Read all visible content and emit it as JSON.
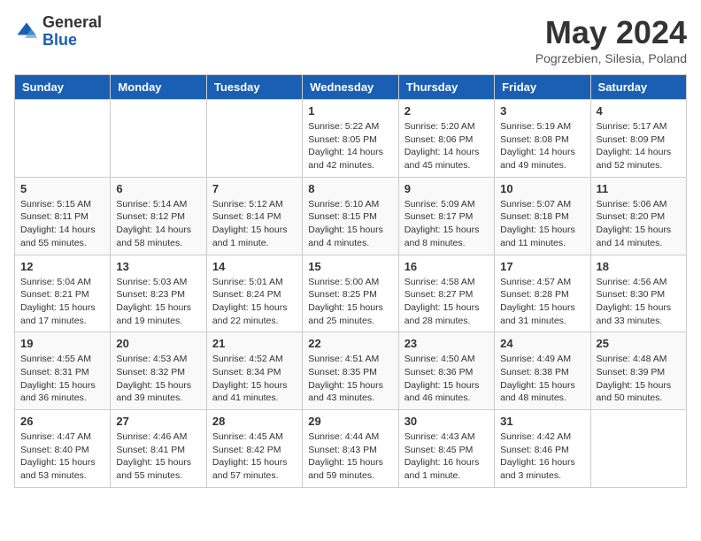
{
  "logo": {
    "general": "General",
    "blue": "Blue"
  },
  "header": {
    "month": "May 2024",
    "location": "Pogrzebien, Silesia, Poland"
  },
  "weekdays": [
    "Sunday",
    "Monday",
    "Tuesday",
    "Wednesday",
    "Thursday",
    "Friday",
    "Saturday"
  ],
  "weeks": [
    [
      {
        "day": "",
        "sunrise": "",
        "sunset": "",
        "daylight": ""
      },
      {
        "day": "",
        "sunrise": "",
        "sunset": "",
        "daylight": ""
      },
      {
        "day": "",
        "sunrise": "",
        "sunset": "",
        "daylight": ""
      },
      {
        "day": "1",
        "sunrise": "Sunrise: 5:22 AM",
        "sunset": "Sunset: 8:05 PM",
        "daylight": "Daylight: 14 hours and 42 minutes."
      },
      {
        "day": "2",
        "sunrise": "Sunrise: 5:20 AM",
        "sunset": "Sunset: 8:06 PM",
        "daylight": "Daylight: 14 hours and 45 minutes."
      },
      {
        "day": "3",
        "sunrise": "Sunrise: 5:19 AM",
        "sunset": "Sunset: 8:08 PM",
        "daylight": "Daylight: 14 hours and 49 minutes."
      },
      {
        "day": "4",
        "sunrise": "Sunrise: 5:17 AM",
        "sunset": "Sunset: 8:09 PM",
        "daylight": "Daylight: 14 hours and 52 minutes."
      }
    ],
    [
      {
        "day": "5",
        "sunrise": "Sunrise: 5:15 AM",
        "sunset": "Sunset: 8:11 PM",
        "daylight": "Daylight: 14 hours and 55 minutes."
      },
      {
        "day": "6",
        "sunrise": "Sunrise: 5:14 AM",
        "sunset": "Sunset: 8:12 PM",
        "daylight": "Daylight: 14 hours and 58 minutes."
      },
      {
        "day": "7",
        "sunrise": "Sunrise: 5:12 AM",
        "sunset": "Sunset: 8:14 PM",
        "daylight": "Daylight: 15 hours and 1 minute."
      },
      {
        "day": "8",
        "sunrise": "Sunrise: 5:10 AM",
        "sunset": "Sunset: 8:15 PM",
        "daylight": "Daylight: 15 hours and 4 minutes."
      },
      {
        "day": "9",
        "sunrise": "Sunrise: 5:09 AM",
        "sunset": "Sunset: 8:17 PM",
        "daylight": "Daylight: 15 hours and 8 minutes."
      },
      {
        "day": "10",
        "sunrise": "Sunrise: 5:07 AM",
        "sunset": "Sunset: 8:18 PM",
        "daylight": "Daylight: 15 hours and 11 minutes."
      },
      {
        "day": "11",
        "sunrise": "Sunrise: 5:06 AM",
        "sunset": "Sunset: 8:20 PM",
        "daylight": "Daylight: 15 hours and 14 minutes."
      }
    ],
    [
      {
        "day": "12",
        "sunrise": "Sunrise: 5:04 AM",
        "sunset": "Sunset: 8:21 PM",
        "daylight": "Daylight: 15 hours and 17 minutes."
      },
      {
        "day": "13",
        "sunrise": "Sunrise: 5:03 AM",
        "sunset": "Sunset: 8:23 PM",
        "daylight": "Daylight: 15 hours and 19 minutes."
      },
      {
        "day": "14",
        "sunrise": "Sunrise: 5:01 AM",
        "sunset": "Sunset: 8:24 PM",
        "daylight": "Daylight: 15 hours and 22 minutes."
      },
      {
        "day": "15",
        "sunrise": "Sunrise: 5:00 AM",
        "sunset": "Sunset: 8:25 PM",
        "daylight": "Daylight: 15 hours and 25 minutes."
      },
      {
        "day": "16",
        "sunrise": "Sunrise: 4:58 AM",
        "sunset": "Sunset: 8:27 PM",
        "daylight": "Daylight: 15 hours and 28 minutes."
      },
      {
        "day": "17",
        "sunrise": "Sunrise: 4:57 AM",
        "sunset": "Sunset: 8:28 PM",
        "daylight": "Daylight: 15 hours and 31 minutes."
      },
      {
        "day": "18",
        "sunrise": "Sunrise: 4:56 AM",
        "sunset": "Sunset: 8:30 PM",
        "daylight": "Daylight: 15 hours and 33 minutes."
      }
    ],
    [
      {
        "day": "19",
        "sunrise": "Sunrise: 4:55 AM",
        "sunset": "Sunset: 8:31 PM",
        "daylight": "Daylight: 15 hours and 36 minutes."
      },
      {
        "day": "20",
        "sunrise": "Sunrise: 4:53 AM",
        "sunset": "Sunset: 8:32 PM",
        "daylight": "Daylight: 15 hours and 39 minutes."
      },
      {
        "day": "21",
        "sunrise": "Sunrise: 4:52 AM",
        "sunset": "Sunset: 8:34 PM",
        "daylight": "Daylight: 15 hours and 41 minutes."
      },
      {
        "day": "22",
        "sunrise": "Sunrise: 4:51 AM",
        "sunset": "Sunset: 8:35 PM",
        "daylight": "Daylight: 15 hours and 43 minutes."
      },
      {
        "day": "23",
        "sunrise": "Sunrise: 4:50 AM",
        "sunset": "Sunset: 8:36 PM",
        "daylight": "Daylight: 15 hours and 46 minutes."
      },
      {
        "day": "24",
        "sunrise": "Sunrise: 4:49 AM",
        "sunset": "Sunset: 8:38 PM",
        "daylight": "Daylight: 15 hours and 48 minutes."
      },
      {
        "day": "25",
        "sunrise": "Sunrise: 4:48 AM",
        "sunset": "Sunset: 8:39 PM",
        "daylight": "Daylight: 15 hours and 50 minutes."
      }
    ],
    [
      {
        "day": "26",
        "sunrise": "Sunrise: 4:47 AM",
        "sunset": "Sunset: 8:40 PM",
        "daylight": "Daylight: 15 hours and 53 minutes."
      },
      {
        "day": "27",
        "sunrise": "Sunrise: 4:46 AM",
        "sunset": "Sunset: 8:41 PM",
        "daylight": "Daylight: 15 hours and 55 minutes."
      },
      {
        "day": "28",
        "sunrise": "Sunrise: 4:45 AM",
        "sunset": "Sunset: 8:42 PM",
        "daylight": "Daylight: 15 hours and 57 minutes."
      },
      {
        "day": "29",
        "sunrise": "Sunrise: 4:44 AM",
        "sunset": "Sunset: 8:43 PM",
        "daylight": "Daylight: 15 hours and 59 minutes."
      },
      {
        "day": "30",
        "sunrise": "Sunrise: 4:43 AM",
        "sunset": "Sunset: 8:45 PM",
        "daylight": "Daylight: 16 hours and 1 minute."
      },
      {
        "day": "31",
        "sunrise": "Sunrise: 4:42 AM",
        "sunset": "Sunset: 8:46 PM",
        "daylight": "Daylight: 16 hours and 3 minutes."
      },
      {
        "day": "",
        "sunrise": "",
        "sunset": "",
        "daylight": ""
      }
    ]
  ]
}
